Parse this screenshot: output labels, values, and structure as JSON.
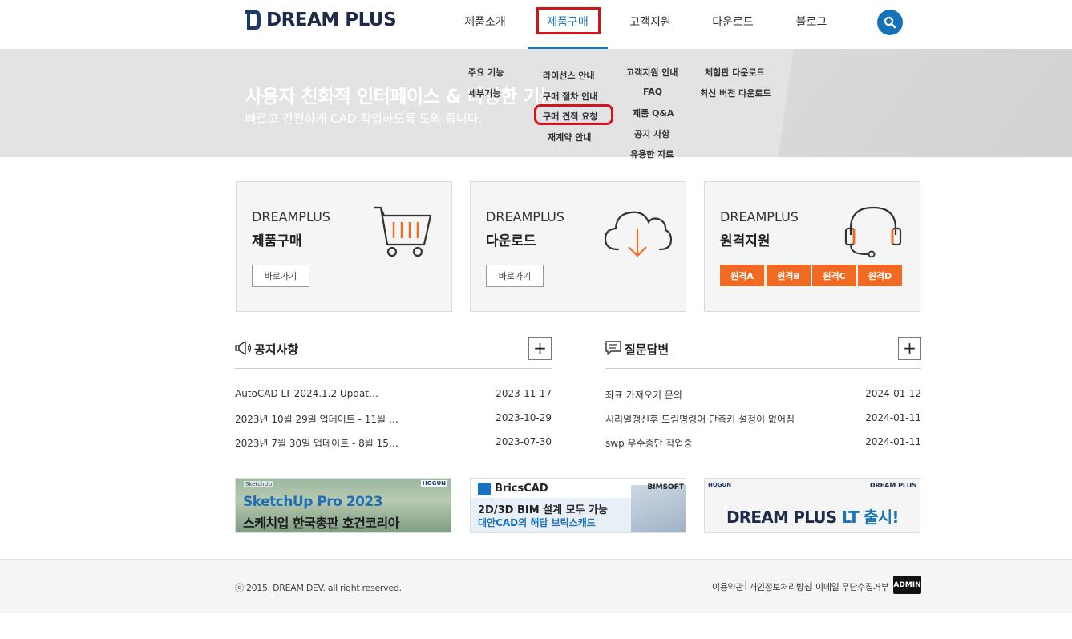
{
  "header": {
    "logo_text": "DREAM PLUS",
    "nav": [
      "제품소개",
      "제품구매",
      "고객지원",
      "다운로드",
      "블로그"
    ],
    "active_index": 1
  },
  "banner": {
    "title": "사용자 친화적 인터페이스 & 다양한 기능",
    "subtitle": "빠르고 간편하게 CAD 작업하도록 도와 줍니다."
  },
  "dropdown": {
    "intro": [
      "주요 기능",
      "세부기능"
    ],
    "purchase": [
      "라이선스 안내",
      "구매 절차 안내",
      "구매 견적 요청",
      "재계약 안내"
    ],
    "support": [
      "고객지원 안내",
      "FAQ",
      "제품 Q&A",
      "공지 사항",
      "유용한 자료"
    ],
    "download": [
      "체험판 다운로드",
      "최신 버전 다운로드"
    ]
  },
  "cards": [
    {
      "brand": "DREAMPLUS",
      "title": "제품구매",
      "button": "바로가기",
      "icon": "shopping-cart-icon"
    },
    {
      "brand": "DREAMPLUS",
      "title": "다운로드",
      "button": "바로가기",
      "icon": "cloud-download-icon"
    },
    {
      "brand": "DREAMPLUS",
      "title": "원격지원",
      "icon": "headset-icon",
      "remote_buttons": [
        "원격A",
        "원격B",
        "원격C",
        "원격D"
      ]
    }
  ],
  "notice": {
    "title": "공지사항",
    "icon": "megaphone-icon",
    "items": [
      {
        "title": "AutoCAD LT 2024.1.2 Updat…",
        "date": "2023-11-17"
      },
      {
        "title": "2023년 10월 29일 업데이트 - 11월 …",
        "date": "2023-10-29"
      },
      {
        "title": "2023년 7월 30일 업데이트 - 8월 15…",
        "date": "2023-07-30"
      }
    ]
  },
  "qna": {
    "title": "질문답변",
    "icon": "chat-icon",
    "items": [
      {
        "title": "좌표 가져오기 문의",
        "date": "2024-01-12"
      },
      {
        "title": "시리얼갱신후 드림명령어 단축키 설정이 없어짐",
        "date": "2024-01-11"
      },
      {
        "title": "swp 우수종단 작업중",
        "date": "2024-01-11"
      }
    ]
  },
  "ads": [
    {
      "badge_left": "SketchUp",
      "badge_right": "HOGUN",
      "line1": "SketchUp Pro 2023",
      "line2": "스케치업 한국총판 호건코리아"
    },
    {
      "brand": "BricsCAD",
      "badge": "BIMSOFT",
      "line1": "2D/3D BIM 설계 모두 가능",
      "line2": "대안CAD의 해답 브릭스캐드"
    },
    {
      "badge_left": "HOGUN",
      "badge_right": "DREAM PLUS",
      "line1a": "DREAM PLUS ",
      "line1b": "LT 출시!"
    }
  ],
  "footer": {
    "copyright": "ⓒ 2015. DREAM DEV. all right reserved.",
    "links": [
      "이용약관",
      "개인정보처리방침",
      "이메일 무단수집거부"
    ],
    "admin": "ADMIN"
  },
  "colors": {
    "accent": "#1b74b8",
    "highlight": "#d4141c",
    "orange": "#f26a21"
  }
}
